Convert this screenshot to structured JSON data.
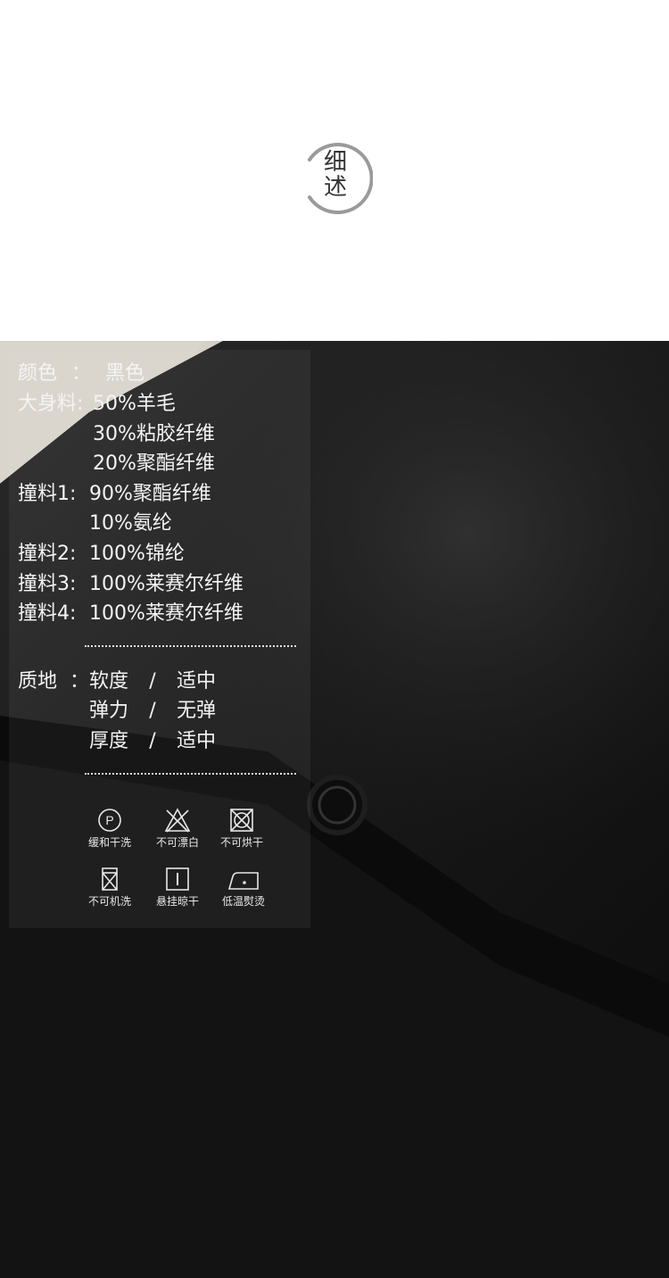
{
  "badge": {
    "line1": "细",
    "line2": "述"
  },
  "specs": {
    "color_label": "颜色",
    "color_sep": "：",
    "color_value": "黑色",
    "body_label": "大身料:",
    "body_values": [
      "50%羊毛",
      "30%粘胶纤维",
      "20%聚酯纤维"
    ],
    "contrast1_label": "撞料1:",
    "contrast1_values": [
      "90%聚酯纤维",
      "10%氨纶"
    ],
    "contrast2_label": "撞料2:",
    "contrast2_value": "100%锦纶",
    "contrast3_label": "撞料3:",
    "contrast3_value": "100%莱赛尔纤维",
    "contrast4_label": "撞料4:",
    "contrast4_value": "100%莱赛尔纤维"
  },
  "texture": {
    "label": "质地",
    "sep": "：",
    "rows": [
      {
        "name": "软度",
        "slash": "/",
        "value": "适中"
      },
      {
        "name": "弹力",
        "slash": "/",
        "value": "无弹"
      },
      {
        "name": "厚度",
        "slash": "/",
        "value": "适中"
      }
    ]
  },
  "care": [
    {
      "icon": "dry-clean-p-icon",
      "label": "缓和干洗"
    },
    {
      "icon": "no-bleach-icon",
      "label": "不可漂白"
    },
    {
      "icon": "no-tumble-dry-icon",
      "label": "不可烘干"
    },
    {
      "icon": "no-machine-wash-icon",
      "label": "不可机洗"
    },
    {
      "icon": "hang-dry-shade-icon",
      "label": "悬挂晾干"
    },
    {
      "icon": "low-iron-icon",
      "label": "低温熨烫"
    }
  ]
}
